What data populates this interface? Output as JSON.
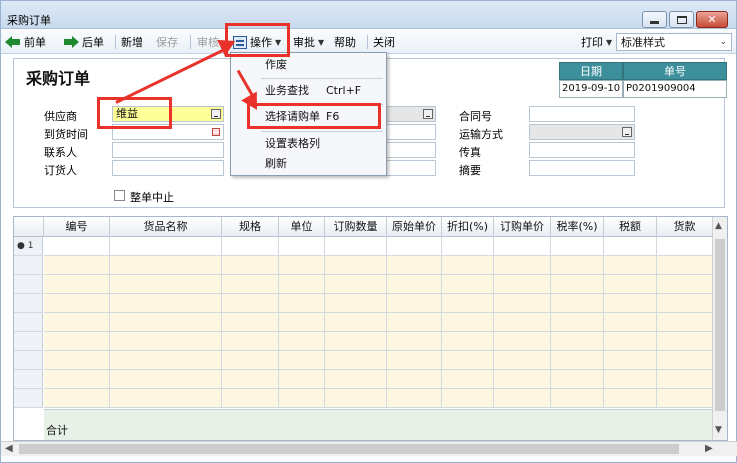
{
  "window": {
    "title": "采购订单"
  },
  "toolbar": {
    "prev": "前单",
    "next": "后单",
    "new": "新增",
    "save": "保存",
    "audit": "审核",
    "operate": "操作",
    "approve": "审批",
    "help": "帮助",
    "close": "关闭",
    "print": "打印",
    "print_style": "标准样式"
  },
  "form": {
    "title": "采购订单",
    "info": {
      "date_label": "日期",
      "number_label": "单号",
      "date": "2019-09-10",
      "number": "P0201909004"
    },
    "labels": {
      "supplier": "供应商",
      "arrival_time": "到货时间",
      "contact": "联系人",
      "orderer": "订货人",
      "contract_no": "合同号",
      "shipping": "运输方式",
      "fax": "传真",
      "summary": "摘要",
      "stop_whole": "整单中止"
    },
    "values": {
      "supplier": "维益"
    }
  },
  "menu": {
    "items": [
      {
        "label": "作废",
        "shortcut": ""
      },
      {
        "label": "业务查找",
        "shortcut": "Ctrl+F"
      },
      {
        "label": "选择请购单",
        "shortcut": "F6"
      },
      {
        "label": "设置表格列",
        "shortcut": ""
      },
      {
        "label": "刷新",
        "shortcut": ""
      }
    ]
  },
  "grid": {
    "columns": [
      "编号",
      "货品名称",
      "规格",
      "单位",
      "订购数量",
      "原始单价",
      "折扣(%)",
      "订购单价",
      "税率(%)",
      "税额",
      "货款"
    ],
    "first_row_marker": "1",
    "total_label": "合计"
  },
  "colors": {
    "accent_red": "#e8322a",
    "header_teal": "#3d8f9c",
    "highlight_yellow": "#ffff99"
  }
}
